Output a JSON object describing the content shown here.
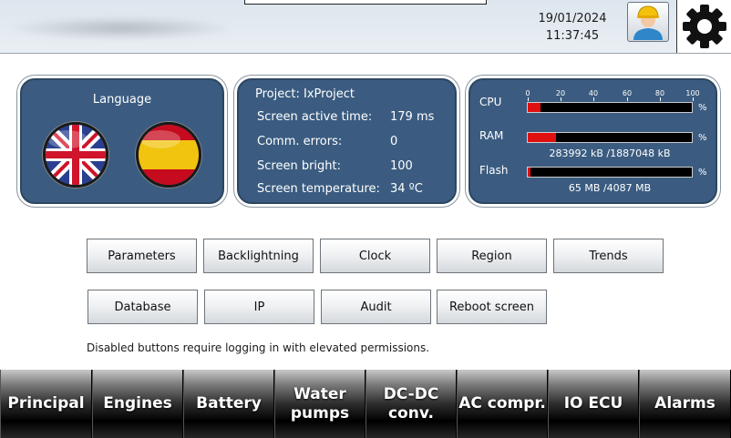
{
  "header": {
    "date": "19/01/2024",
    "time": "11:37:45",
    "user_icon": "user-worker-icon",
    "settings_icon": "gear-icon"
  },
  "language_panel": {
    "title": "Language",
    "flags": [
      {
        "name": "uk-flag-icon"
      },
      {
        "name": "spain-flag-icon"
      }
    ]
  },
  "project_panel": {
    "title": "Project: IxProject",
    "rows": [
      {
        "key": "Screen active time:",
        "value": "179 ms"
      },
      {
        "key": "Comm. errors:",
        "value": "0"
      },
      {
        "key": "Screen bright:",
        "value": "100"
      },
      {
        "key": "Screen temperature:",
        "value": "34 ºC"
      }
    ]
  },
  "system_panel": {
    "ticks": [
      "0",
      "20",
      "40",
      "60",
      "80",
      "100"
    ],
    "pct_unit": "%",
    "cpu": {
      "label": "CPU",
      "value_pct": 8
    },
    "ram": {
      "label": "RAM",
      "value_pct": 17,
      "detail": "283992 kB /1887048 kB"
    },
    "flash": {
      "label": "Flash",
      "value_pct": 1.5,
      "detail": "65 MB /4087 MB"
    },
    "bar_fill_color": "#e01010"
  },
  "buttons": {
    "row1": [
      "Parameters",
      "Backlightning",
      "Clock",
      "Region",
      "Trends"
    ],
    "row2": [
      "Database",
      "IP",
      "Audit",
      "Reboot screen"
    ]
  },
  "note": "Disabled buttons require logging in with elevated permissions.",
  "nav": [
    "Principal",
    "Engines",
    "Battery",
    "Water\npumps",
    "DC-DC\nconv.",
    "AC compr.",
    "IO ECU",
    "Alarms"
  ]
}
